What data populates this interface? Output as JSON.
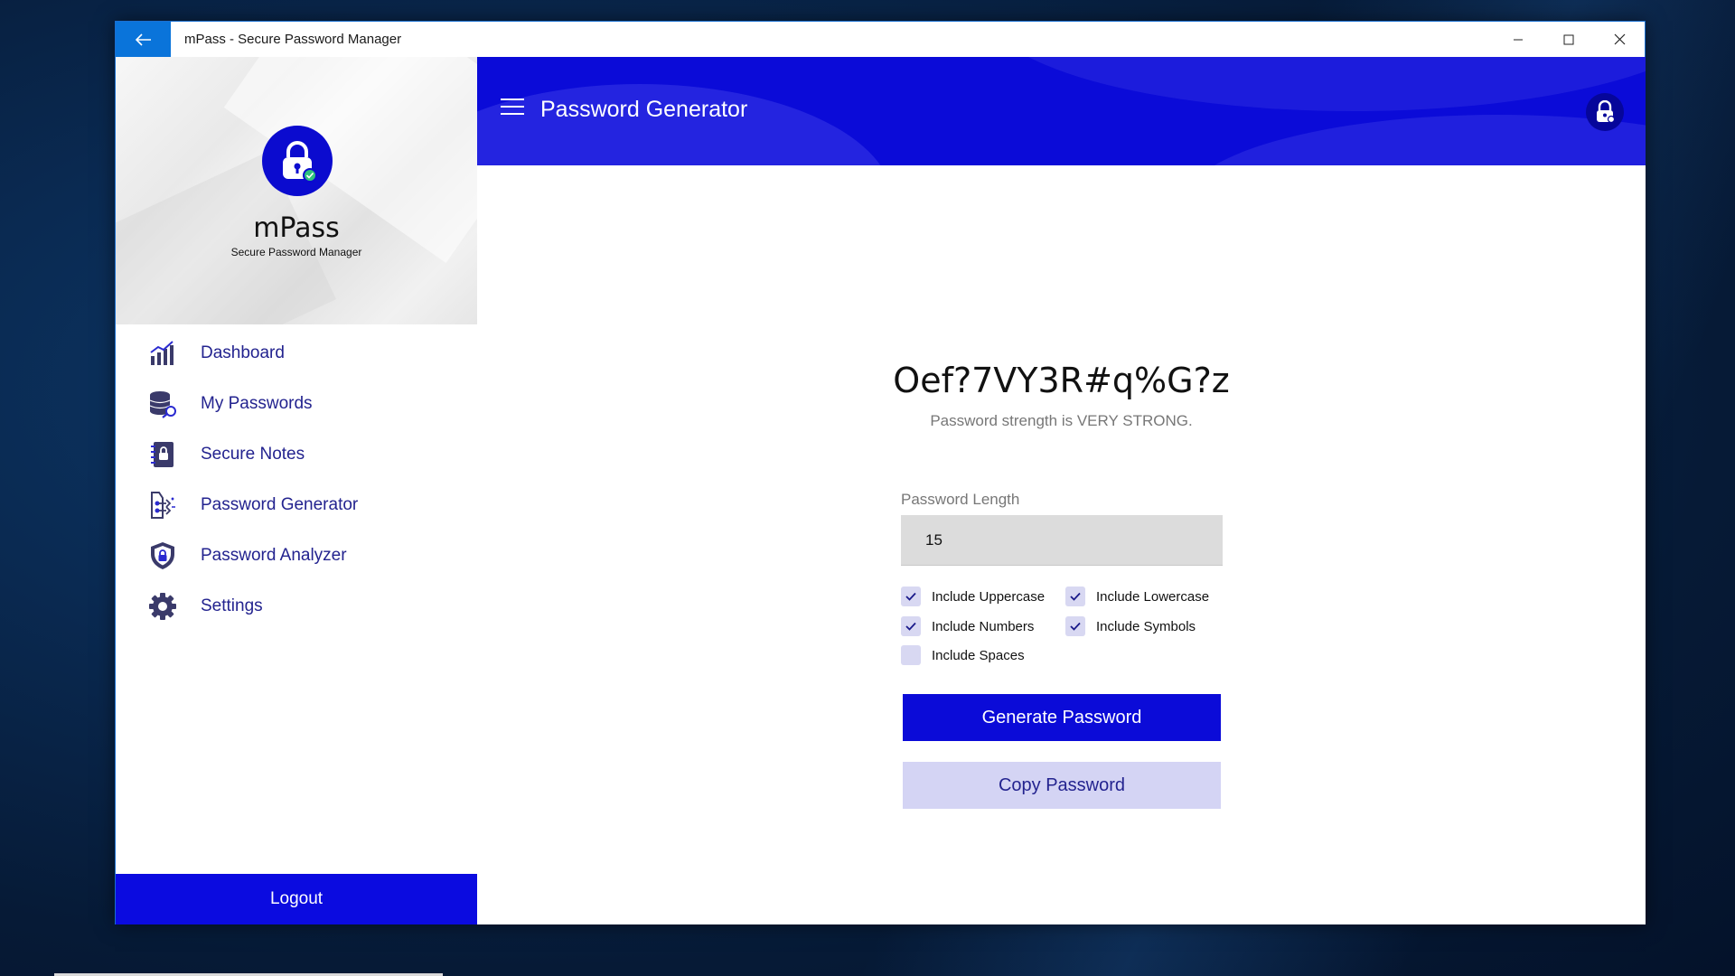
{
  "window": {
    "title": "mPass - Secure Password Manager",
    "back_icon": "arrow-left-icon",
    "controls": [
      "minimize-icon",
      "maximize-icon",
      "close-icon"
    ]
  },
  "sidebar": {
    "app_name": "mPass",
    "app_subtitle": "Secure Password Manager",
    "items": [
      {
        "label": "Dashboard",
        "icon": "chart-icon"
      },
      {
        "label": "My Passwords",
        "icon": "database-key-icon"
      },
      {
        "label": "Secure Notes",
        "icon": "notebook-lock-icon"
      },
      {
        "label": "Password Generator",
        "icon": "generator-icon"
      },
      {
        "label": "Password Analyzer",
        "icon": "shield-lock-icon"
      },
      {
        "label": "Settings",
        "icon": "gear-icon"
      }
    ],
    "logout_label": "Logout"
  },
  "header": {
    "title": "Password Generator"
  },
  "generator": {
    "password": "Oef?7VY3R#q%G?z",
    "strength_text": "Password strength is VERY STRONG.",
    "length_label": "Password Length",
    "length_value": "15",
    "options": [
      {
        "label": "Include Uppercase",
        "checked": true
      },
      {
        "label": "Include Lowercase",
        "checked": true
      },
      {
        "label": "Include Numbers",
        "checked": true
      },
      {
        "label": "Include Symbols",
        "checked": true
      },
      {
        "label": "Include Spaces",
        "checked": false
      }
    ],
    "generate_label": "Generate Password",
    "copy_label": "Copy Password"
  },
  "colors": {
    "accent": "#0b0bd8",
    "nav_text": "#23238f",
    "titlebar_back": "#0a74da",
    "checkbox_bg": "#d8d8f2",
    "copy_bg": "#d4d4f4"
  }
}
